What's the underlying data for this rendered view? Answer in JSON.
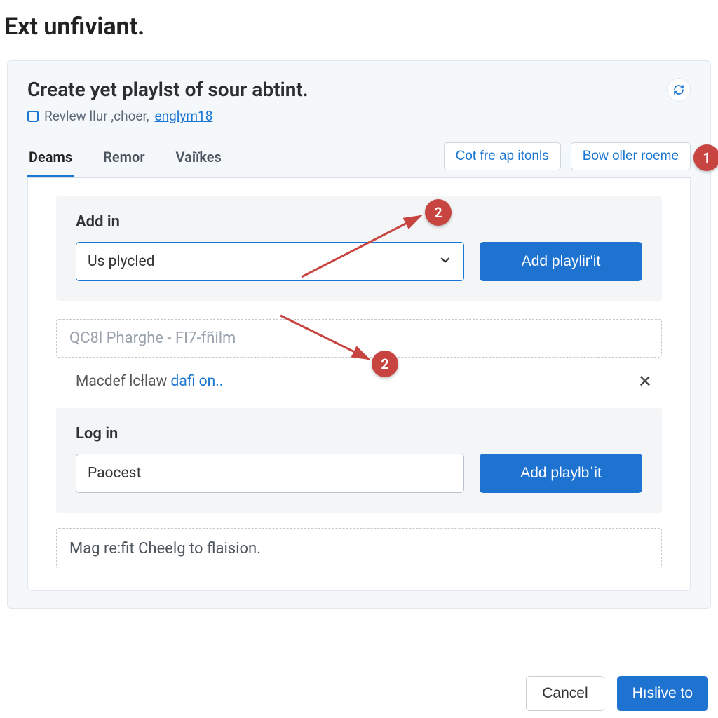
{
  "page": {
    "title": "Ext unfiviant."
  },
  "panel": {
    "title": "Create yet playlst of sour abtint.",
    "sub_prefix": "Revlew llur ,choer,",
    "sub_link": "englym18",
    "tabs": [
      {
        "label": "Deams",
        "active": true
      },
      {
        "label": "Remor",
        "active": false
      },
      {
        "label": "Vaiïkes",
        "active": false
      }
    ],
    "actions": {
      "left": "Cot fre ap itonls",
      "right": "Bow oller roeme"
    }
  },
  "block1": {
    "title": "Add in",
    "select_value": "Us plycled",
    "button_label": "Add playlir'it"
  },
  "dashed1": "QC8l Pharghe - FI7-fñilm",
  "linkline": {
    "prefix": "Macdef lcłlaw ",
    "link": "dafi on.."
  },
  "block2": {
    "title": "Log in",
    "input_value": "Paocest",
    "button_label": "Add playlbˈit"
  },
  "dashed2": "Mag re:fit Cheelg to flaision.",
  "footer": {
    "cancel": "Cancel",
    "submit": "Hıslive to"
  },
  "callouts": {
    "c1": "1",
    "c2a": "2",
    "c2b": "2"
  }
}
